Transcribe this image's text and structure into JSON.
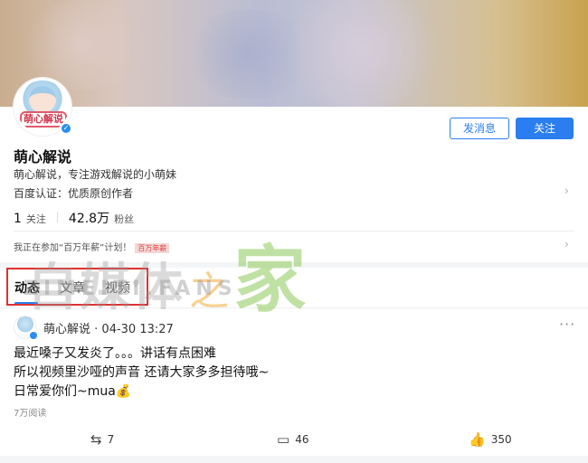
{
  "profile": {
    "name": "萌心解说",
    "avatar_tag": "萌心解说",
    "bio": "萌心解说，专注游戏解说的小萌妹",
    "certification": "百度认证：优质原创作者",
    "following_count": "1",
    "following_label": "关注",
    "followers_count": "42.8万",
    "followers_label": "粉丝",
    "activity_text": "我正在参加“百万年薪”计划！",
    "activity_badge": "百万年薪",
    "message_button": "发消息",
    "follow_button": "关注"
  },
  "tabs": [
    {
      "label": "动态"
    },
    {
      "label": "文章"
    },
    {
      "label": "视频"
    }
  ],
  "post": {
    "author": "萌心解说",
    "time": "04-30 13:27",
    "lines": [
      "最近嗓子又发炎了。。。讲话有点困难",
      "所以视频里沙哑的声音  还请大家多多担待哦~",
      "日常爱你们~mua"
    ],
    "reads": "7万阅读",
    "reposts": "7",
    "comments": "46",
    "likes": "350"
  },
  "watermark": {
    "main": "自媒体",
    "sep": "之",
    "home": "家",
    "sub": "ZIMEITI.FANS"
  },
  "colors": {
    "accent": "#2a7ef0",
    "highlight": "#e03030"
  }
}
